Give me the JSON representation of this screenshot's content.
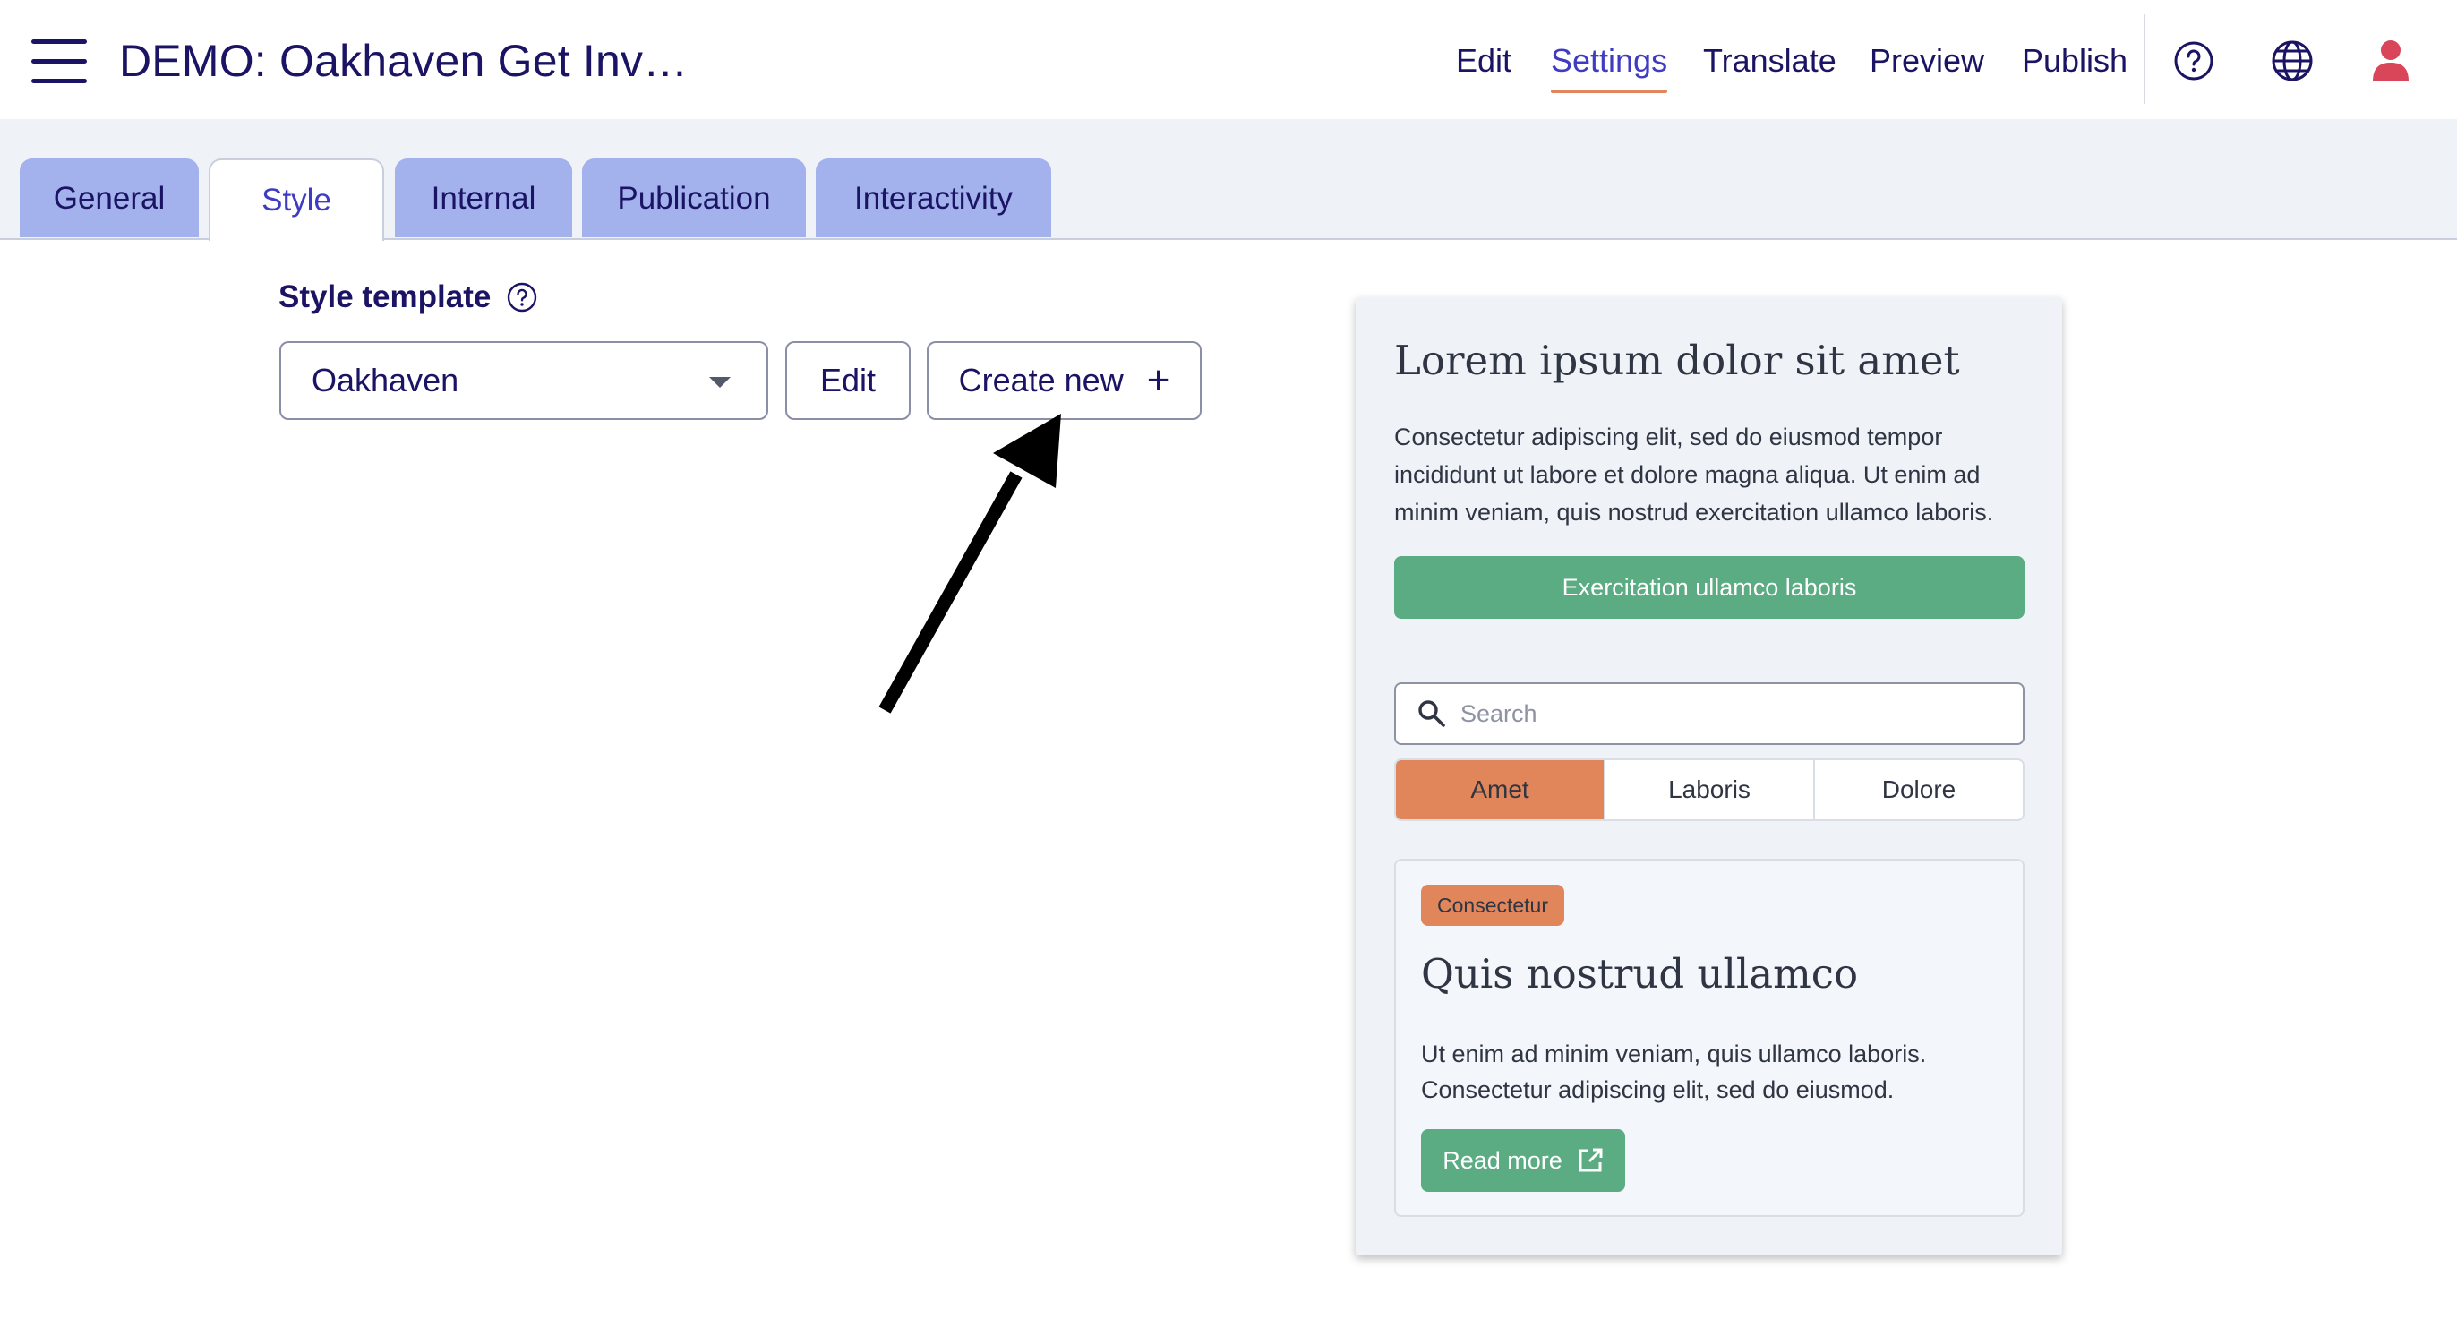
{
  "header": {
    "title": "DEMO: Oakhaven Get Inv…",
    "nav": [
      "Edit",
      "Settings",
      "Translate",
      "Preview",
      "Publish"
    ],
    "active_nav": "Settings",
    "icons": [
      "help-icon",
      "globe-icon",
      "user-icon"
    ]
  },
  "tabs": [
    "General",
    "Style",
    "Internal",
    "Publication",
    "Interactivity"
  ],
  "active_tab": "Style",
  "style_template": {
    "label": "Style template",
    "selected": "Oakhaven",
    "edit_label": "Edit",
    "create_label": "Create new"
  },
  "preview": {
    "heading": "Lorem ipsum dolor sit amet",
    "body": "Consectetur adipiscing elit, sed do eiusmod tempor incididunt ut labore et dolore magna aliqua. Ut enim ad minim veniam, quis nostrud exercitation ullamco laboris.",
    "primary_button": "Exercitation ullamco laboris",
    "search_placeholder": "Search",
    "segments": [
      "Amet",
      "Laboris",
      "Dolore"
    ],
    "active_segment": "Amet",
    "card": {
      "badge": "Consectetur",
      "title": "Quis nostrud ullamco",
      "text": "Ut enim ad minim veniam, quis ullamco laboris. Consectetur adipiscing elit, sed do eiusmod.",
      "button": "Read more"
    }
  },
  "colors": {
    "brand": "#1b1464",
    "accent": "#3f3bc3",
    "tab_inactive": "#a3b1ec",
    "green": "#5bab83",
    "orange": "#e0865a"
  }
}
